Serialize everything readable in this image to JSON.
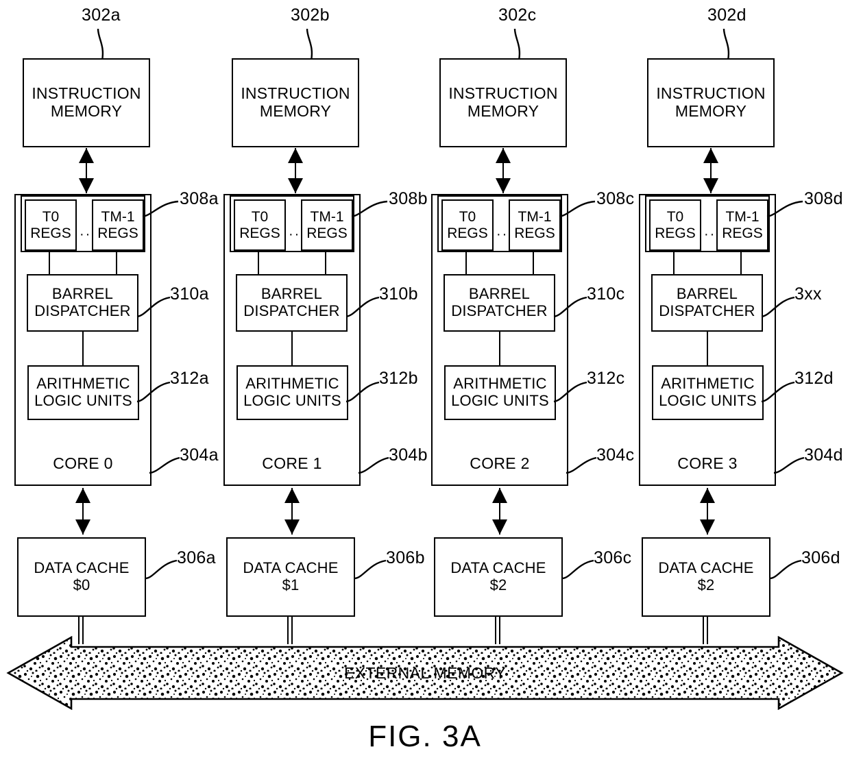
{
  "figure": {
    "caption": "FIG. 3A",
    "external_memory_label": "EXTERNAL MEMORY"
  },
  "columns": [
    {
      "instruction_memory": {
        "line1": "INSTRUCTION",
        "line2": "MEMORY",
        "ref": "302a"
      },
      "registers": {
        "ref": "308a",
        "first": {
          "line1": "T0",
          "line2": "REGS"
        },
        "ellipsis": "···",
        "last": {
          "line1": "TM-1",
          "line2": "REGS"
        }
      },
      "dispatcher": {
        "line1": "BARREL",
        "line2": "DISPATCHER",
        "ref": "310a"
      },
      "alu": {
        "line1": "ARITHMETIC",
        "line2": "LOGIC UNITS",
        "ref": "312a"
      },
      "core": {
        "label": "CORE 0",
        "ref": "304a"
      },
      "data_cache": {
        "line1": "DATA CACHE",
        "line2": "$0",
        "ref": "306a"
      }
    },
    {
      "instruction_memory": {
        "line1": "INSTRUCTION",
        "line2": "MEMORY",
        "ref": "302b"
      },
      "registers": {
        "ref": "308b",
        "first": {
          "line1": "T0",
          "line2": "REGS"
        },
        "ellipsis": "···",
        "last": {
          "line1": "TM-1",
          "line2": "REGS"
        }
      },
      "dispatcher": {
        "line1": "BARREL",
        "line2": "DISPATCHER",
        "ref": "310b"
      },
      "alu": {
        "line1": "ARITHMETIC",
        "line2": "LOGIC UNITS",
        "ref": "312b"
      },
      "core": {
        "label": "CORE 1",
        "ref": "304b"
      },
      "data_cache": {
        "line1": "DATA CACHE",
        "line2": "$1",
        "ref": "306b"
      }
    },
    {
      "instruction_memory": {
        "line1": "INSTRUCTION",
        "line2": "MEMORY",
        "ref": "302c"
      },
      "registers": {
        "ref": "308c",
        "first": {
          "line1": "T0",
          "line2": "REGS"
        },
        "ellipsis": "···",
        "last": {
          "line1": "TM-1",
          "line2": "REGS"
        }
      },
      "dispatcher": {
        "line1": "BARREL",
        "line2": "DISPATCHER",
        "ref": "310c"
      },
      "alu": {
        "line1": "ARITHMETIC",
        "line2": "LOGIC UNITS",
        "ref": "312c"
      },
      "core": {
        "label": "CORE 2",
        "ref": "304c"
      },
      "data_cache": {
        "line1": "DATA CACHE",
        "line2": "$2",
        "ref": "306c"
      }
    },
    {
      "instruction_memory": {
        "line1": "INSTRUCTION",
        "line2": "MEMORY",
        "ref": "302d"
      },
      "registers": {
        "ref": "308d",
        "first": {
          "line1": "T0",
          "line2": "REGS"
        },
        "ellipsis": "···",
        "last": {
          "line1": "TM-1",
          "line2": "REGS"
        }
      },
      "dispatcher": {
        "line1": "BARREL",
        "line2": "DISPATCHER",
        "ref": "3xx"
      },
      "alu": {
        "line1": "ARITHMETIC",
        "line2": "LOGIC UNITS",
        "ref": "312d"
      },
      "core": {
        "label": "CORE 3",
        "ref": "304d"
      },
      "data_cache": {
        "line1": "DATA CACHE",
        "line2": "$2",
        "ref": "306d"
      }
    }
  ],
  "colors": {
    "ink": "#000000",
    "paper": "#ffffff"
  }
}
